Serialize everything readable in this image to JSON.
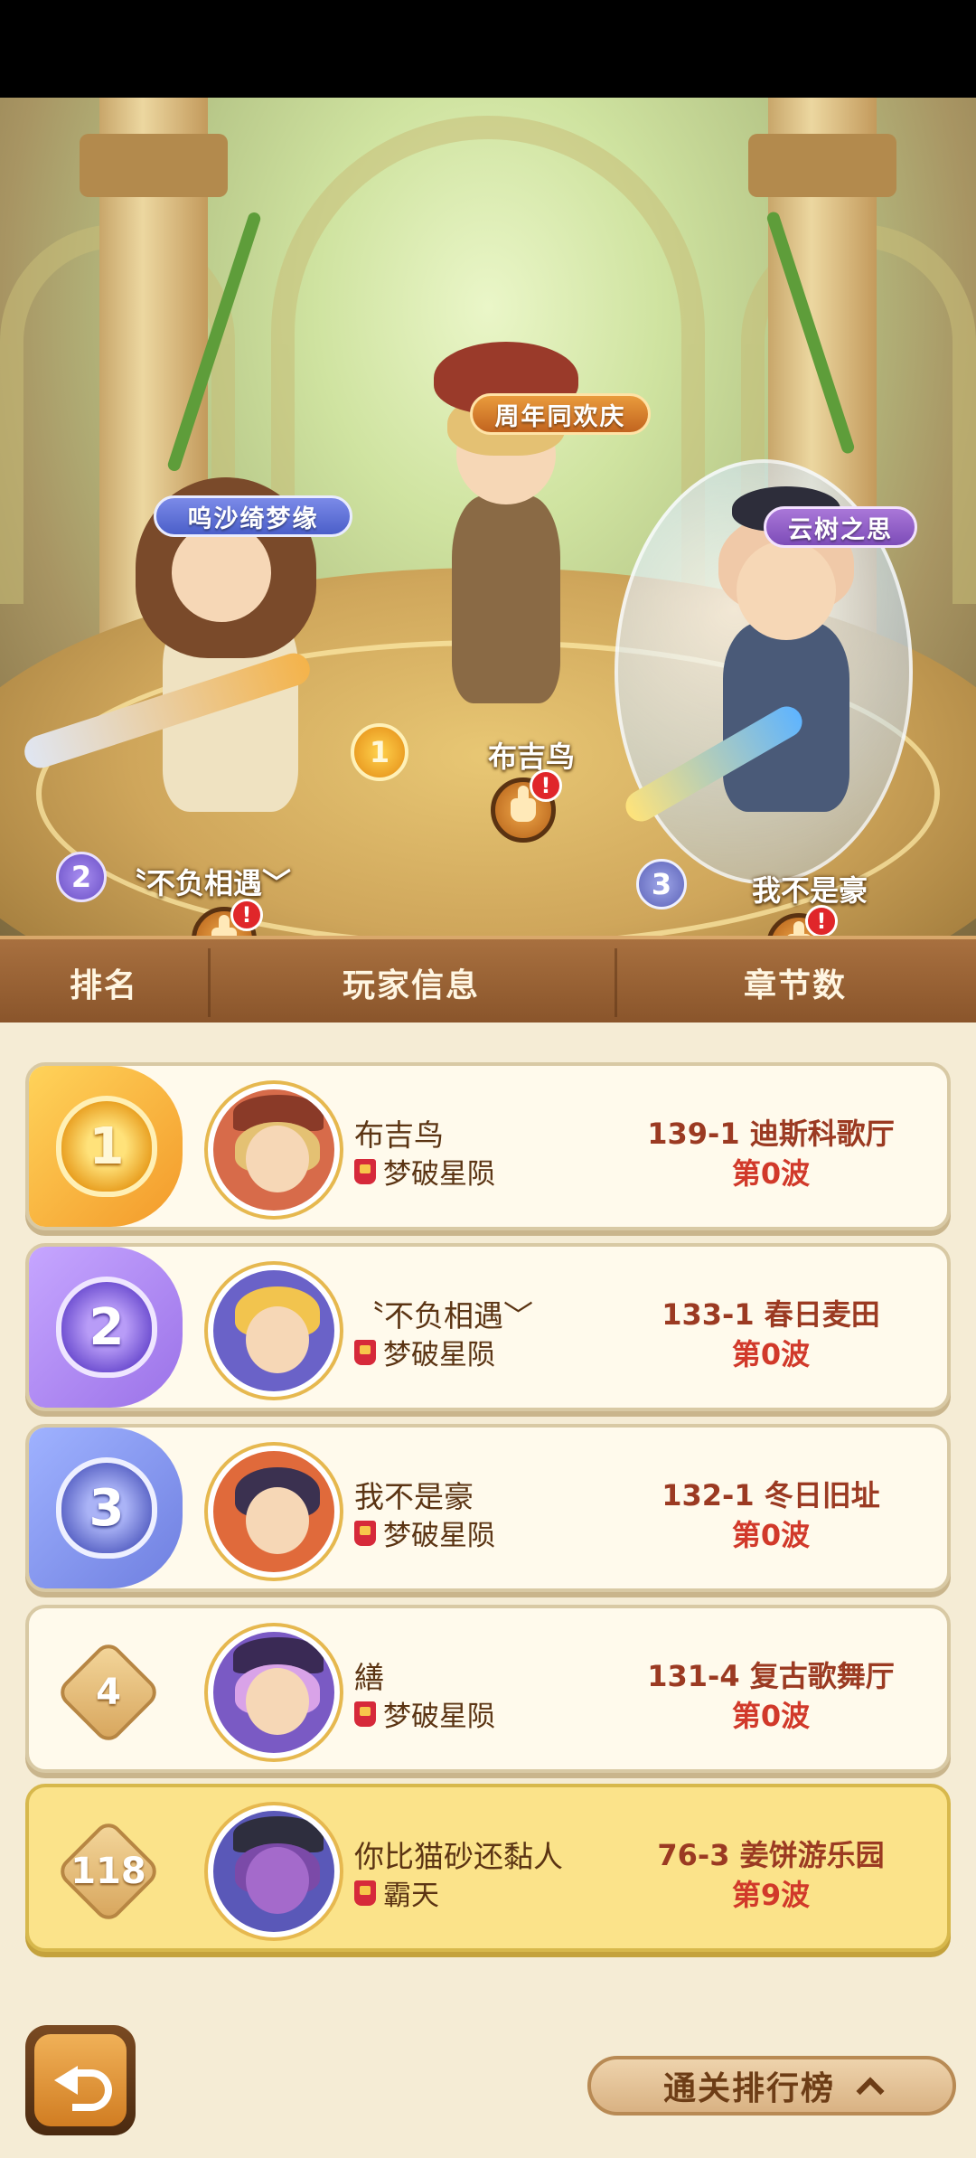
{
  "hero": {
    "event_banner": "周年同欢庆",
    "podium": [
      {
        "rank": "1",
        "name": "布吉鸟",
        "title": ""
      },
      {
        "rank": "2",
        "name": "〝不负相遇﹀",
        "title": "呜沙绮梦缘"
      },
      {
        "rank": "3",
        "name": "我不是豪",
        "title": "云树之思"
      }
    ],
    "like_alert": "!"
  },
  "table": {
    "headers": {
      "rank": "排名",
      "info": "玩家信息",
      "chapter": "章节数"
    },
    "rows": [
      {
        "rank": "1",
        "name": "布吉鸟",
        "guild": "梦破星陨",
        "chapter": "139-1 迪斯科歌厅",
        "wave": "第0波"
      },
      {
        "rank": "2",
        "name": "〝不负相遇﹀",
        "guild": "梦破星陨",
        "chapter": "133-1 春日麦田",
        "wave": "第0波"
      },
      {
        "rank": "3",
        "name": "我不是豪",
        "guild": "梦破星陨",
        "chapter": "132-1 冬日旧址",
        "wave": "第0波"
      },
      {
        "rank": "4",
        "name": "繕",
        "guild": "梦破星陨",
        "chapter": "131-4 复古歌舞厅",
        "wave": "第0波"
      },
      {
        "rank": "118",
        "name": "你比猫砂还黏人",
        "guild": "霸天",
        "chapter": "76-3 姜饼游乐园",
        "wave": "第9波"
      }
    ]
  },
  "footer": {
    "toggle_label": "通关排行榜",
    "back_icon": "back-arrow-icon",
    "toggle_icon": "chevron-up-icon"
  }
}
